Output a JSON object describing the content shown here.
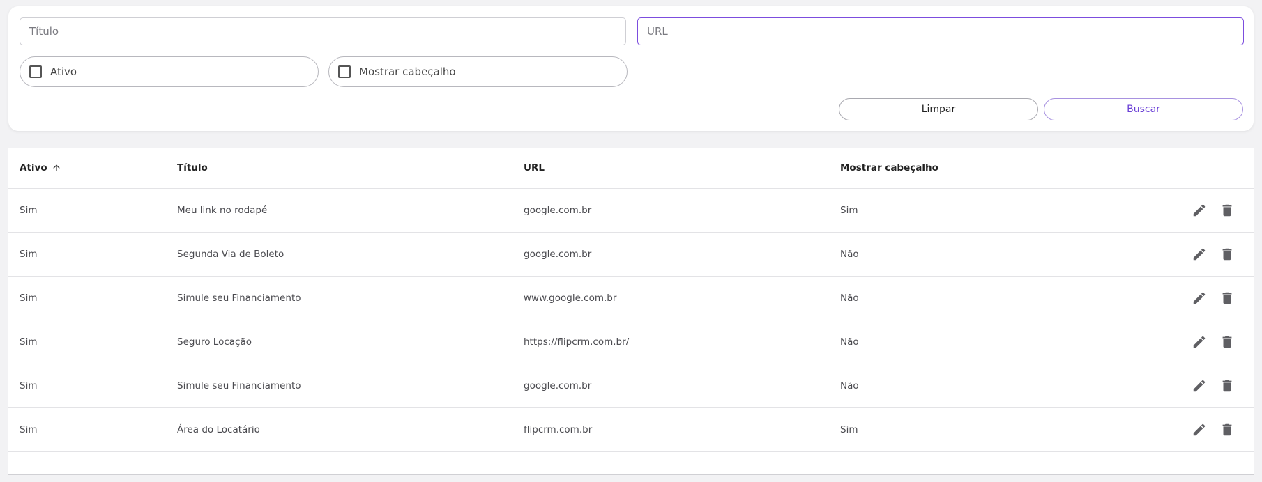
{
  "filters": {
    "titulo_placeholder": "Título",
    "titulo_value": "",
    "url_placeholder": "URL",
    "url_value": "",
    "ativo_label": "Ativo",
    "mostrar_label": "Mostrar cabeçalho",
    "limpar_label": "Limpar",
    "buscar_label": "Buscar"
  },
  "table": {
    "headers": {
      "ativo": "Ativo",
      "titulo": "Título",
      "url": "URL",
      "mostrar": "Mostrar cabeçalho"
    },
    "sort_icon": "arrow-up-icon",
    "rows": [
      {
        "ativo": "Sim",
        "titulo": "Meu link no rodapé",
        "url": "google.com.br",
        "mostrar": "Sim"
      },
      {
        "ativo": "Sim",
        "titulo": "Segunda Via de Boleto",
        "url": "google.com.br",
        "mostrar": "Não"
      },
      {
        "ativo": "Sim",
        "titulo": "Simule seu Financiamento",
        "url": "www.google.com.br",
        "mostrar": "Não"
      },
      {
        "ativo": "Sim",
        "titulo": "Seguro Locação",
        "url": "https://flipcrm.com.br/",
        "mostrar": "Não"
      },
      {
        "ativo": "Sim",
        "titulo": "Simule seu Financiamento",
        "url": "google.com.br",
        "mostrar": "Não"
      },
      {
        "ativo": "Sim",
        "titulo": "Área do Locatário",
        "url": "flipcrm.com.br",
        "mostrar": "Sim"
      }
    ],
    "row_actions": [
      "edit-icon",
      "delete-icon"
    ]
  },
  "colors": {
    "accent": "#7c4dde",
    "background": "#f2f2f4",
    "card": "#ffffff"
  }
}
